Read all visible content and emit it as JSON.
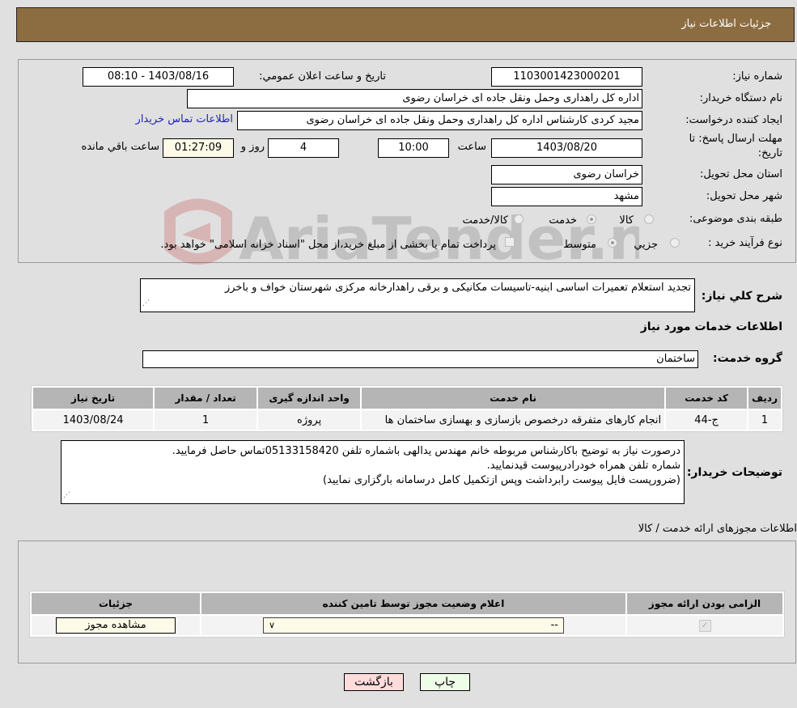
{
  "header": {
    "title": "جزئیات اطلاعات نیاز"
  },
  "need_info": {
    "need_number_label": "شماره نیاز:",
    "need_number": "1103001423000201",
    "announce_label": "تاريخ و ساعت اعلان عمومي:",
    "announce_value": "1403/08/16 - 08:10",
    "buyer_org_label": "نام دستگاه خریدار:",
    "buyer_org": "اداره کل راهداری وحمل ونقل جاده ای خراسان رضوی",
    "creator_label": "ایجاد کننده درخواست:",
    "creator": "مجید کردی کارشناس اداره کل راهداری وحمل ونقل جاده ای خراسان رضوی",
    "contact_link": "اطلاعات تماس خریدار",
    "deadline_label_1": "مهلت ارسال پاسخ: تا",
    "deadline_label_2": "تاریخ:",
    "deadline_date": "1403/08/20",
    "time_label": "ساعت",
    "deadline_time": "10:00",
    "days_value": "4",
    "days_label": "روز و",
    "remaining_time": "01:27:09",
    "remaining_label": "ساعت باقي مانده",
    "province_label": "استان محل تحویل:",
    "province": "خراسان رضوی",
    "city_label": "شهر محل تحویل:",
    "city": "مشهد",
    "category_label": "طبقه بندی موضوعی:",
    "category_options": [
      {
        "label": "کالا",
        "selected": false
      },
      {
        "label": "خدمت",
        "selected": true
      },
      {
        "label": "کالا/خدمت",
        "selected": false
      }
    ],
    "process_label": "نوع فرآیند خرید :",
    "process_options": [
      {
        "label": "جزيي",
        "selected": false
      },
      {
        "label": "متوسط",
        "selected": true
      }
    ],
    "treasury_note": "پرداخت تمام یا بخشی از مبلغ خرید،از محل \"اسناد خزانه اسلامی\" خواهد بود.",
    "treasury_checked": false
  },
  "description": {
    "label": "شرح كلي نياز:",
    "value": "تجدید استعلام تعمیرات اساسی ابنیه-تاسیسات مکانیکی و برقی راهدارخانه مرکزی شهرستان خواف و باخرز"
  },
  "services": {
    "section_title": "اطلاعات خدمات مورد نیاز",
    "group_label": "گروه خدمت:",
    "group_value": "ساختمان",
    "columns": [
      "ردیف",
      "کد خدمت",
      "نام خدمت",
      "واحد اندازه گیری",
      "تعداد / مقدار",
      "تاریخ نیاز"
    ],
    "rows": [
      [
        "1",
        "ج-44",
        "انجام کارهای متفرقه درخصوص بازسازی و بهسازی ساختمان ها",
        "پروژه",
        "1",
        "1403/08/24"
      ]
    ]
  },
  "buyer_notes": {
    "label": "توضیحات خریدار:",
    "lines": [
      "درصورت نیاز به توضیح باکارشناس مربوطه خانم مهندس یدالهی باشماره تلفن 05133158420تماس حاصل فرمایید.",
      "شماره تلفن همراه خودرادرپیوست قیدنمایید.",
      "(ضرورپست فایل پیوست رابرداشت وپس ازتکمیل کامل درسامانه بارگزاری نمایید)"
    ]
  },
  "permits": {
    "section_title": "اطلاعات مجوزهای ارائه خدمت / کالا",
    "columns": [
      "الزامی بودن ارائه مجوز",
      "اعلام وضعیت مجوز توسط تامین کننده",
      "جزئیات"
    ],
    "rows": [
      {
        "required": true,
        "status_selected": "--",
        "details_button": "مشاهده مجوز"
      }
    ]
  },
  "footer": {
    "print_button": "چاپ",
    "back_button": "بازگشت"
  },
  "watermark": {
    "text": "AriaTender.neT"
  }
}
